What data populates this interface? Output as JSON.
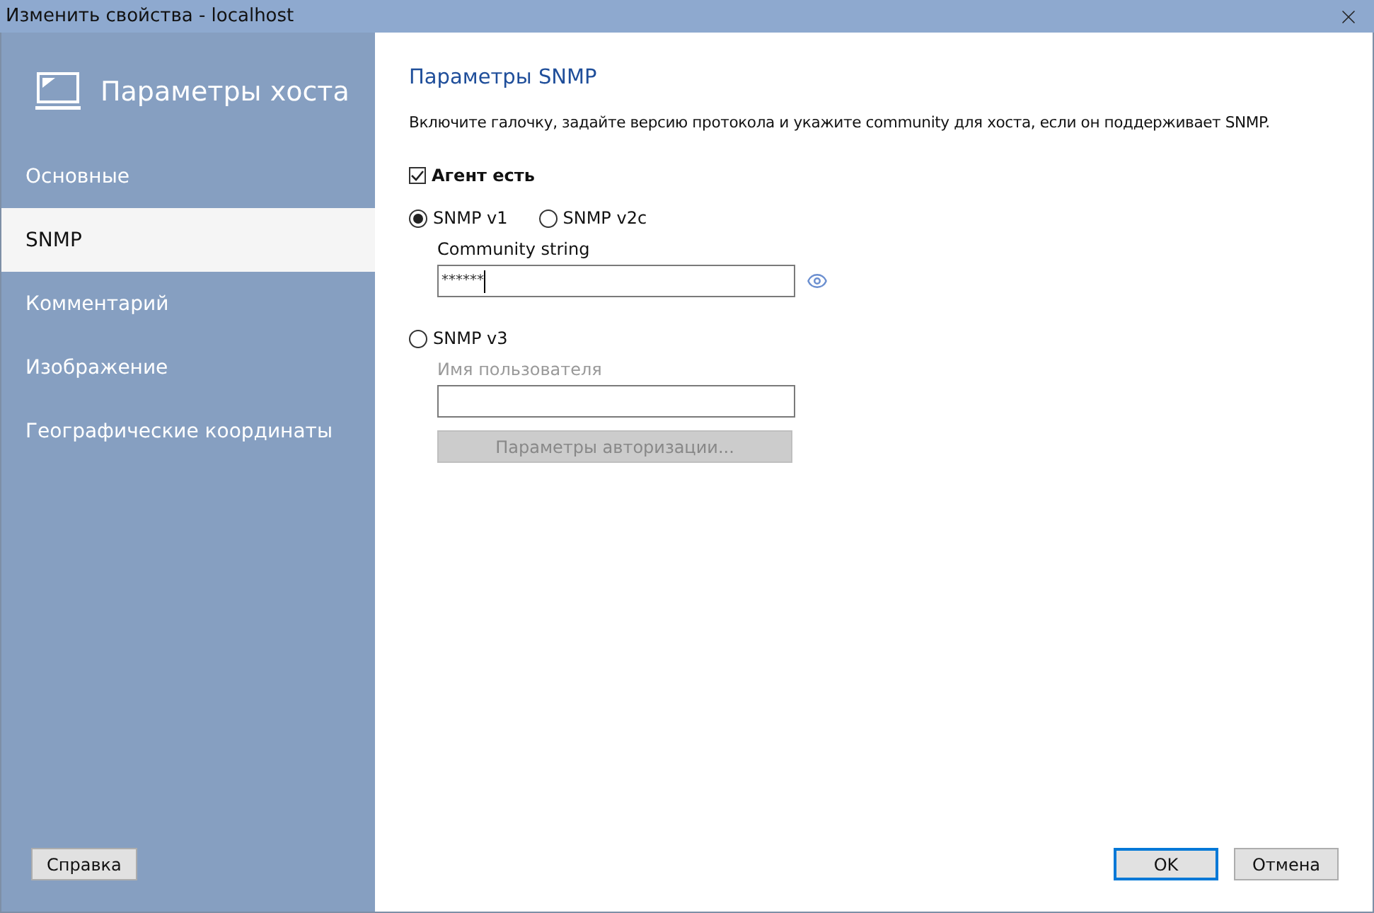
{
  "window": {
    "title": "Изменить свойства - localhost"
  },
  "sidebar": {
    "title": "Параметры хоста",
    "items": [
      {
        "label": "Основные",
        "selected": false
      },
      {
        "label": "SNMP",
        "selected": true
      },
      {
        "label": "Комментарий",
        "selected": false
      },
      {
        "label": "Изображение",
        "selected": false
      },
      {
        "label": "Географические координаты",
        "selected": false
      }
    ],
    "help_button": "Справка"
  },
  "content": {
    "title": "Параметры SNMP",
    "description": "Включите галочку, задайте версию протокола и укажите community для хоста,  если он поддерживает SNMP.",
    "agent": {
      "label": "Агент есть",
      "checked": true
    },
    "versions": [
      {
        "label": "SNMP v1",
        "selected": true
      },
      {
        "label": "SNMP v2c",
        "selected": false
      }
    ],
    "community": {
      "label": "Community string",
      "value": "******"
    },
    "v3": {
      "label": "SNMP v3",
      "selected": false,
      "user_label": "Имя пользователя",
      "auth_button": "Параметры авторизации...",
      "disabled": true
    }
  },
  "buttons": [
    {
      "label": "OK",
      "selected": true
    },
    {
      "label": "Отмена",
      "selected": false
    }
  ]
}
